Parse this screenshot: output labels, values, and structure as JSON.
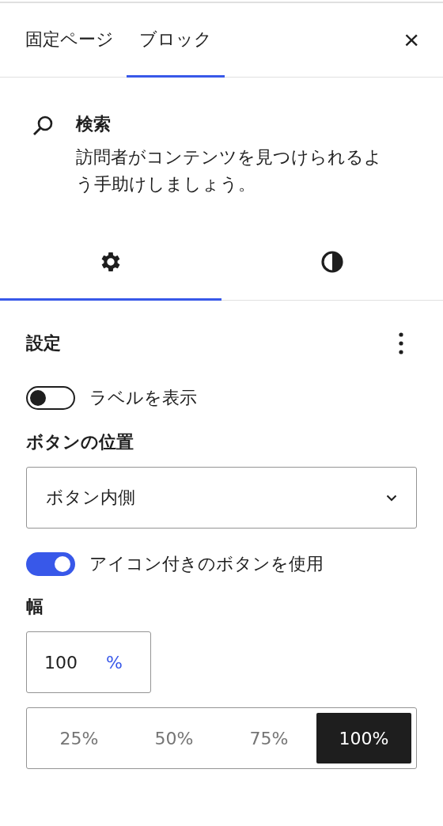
{
  "header_tabs": [
    {
      "label": "固定ページ",
      "selected": false
    },
    {
      "label": "ブロック",
      "selected": true
    }
  ],
  "close": "×",
  "block": {
    "title": "検索",
    "description": "訪問者がコンテンツを見つけられるよう手助けしましょう。"
  },
  "settings_tabs": [
    {
      "kind": "settings",
      "selected": true
    },
    {
      "kind": "styles",
      "selected": false
    }
  ],
  "panel": {
    "title": "設定",
    "controls": [
      {
        "kind": "toggle",
        "label": "ラベルを表示",
        "on": false
      },
      {
        "kind": "select",
        "label": "ボタンの位置",
        "value": "ボタン内側"
      },
      {
        "kind": "toggle",
        "label": "アイコン付きのボタンを使用",
        "on": true
      },
      {
        "kind": "width",
        "label": "幅",
        "value": "100",
        "unit": "%",
        "options": [
          {
            "label": "25%",
            "selected": false
          },
          {
            "label": "50%",
            "selected": false
          },
          {
            "label": "75%",
            "selected": false
          },
          {
            "label": "100%",
            "selected": true
          }
        ]
      }
    ]
  }
}
